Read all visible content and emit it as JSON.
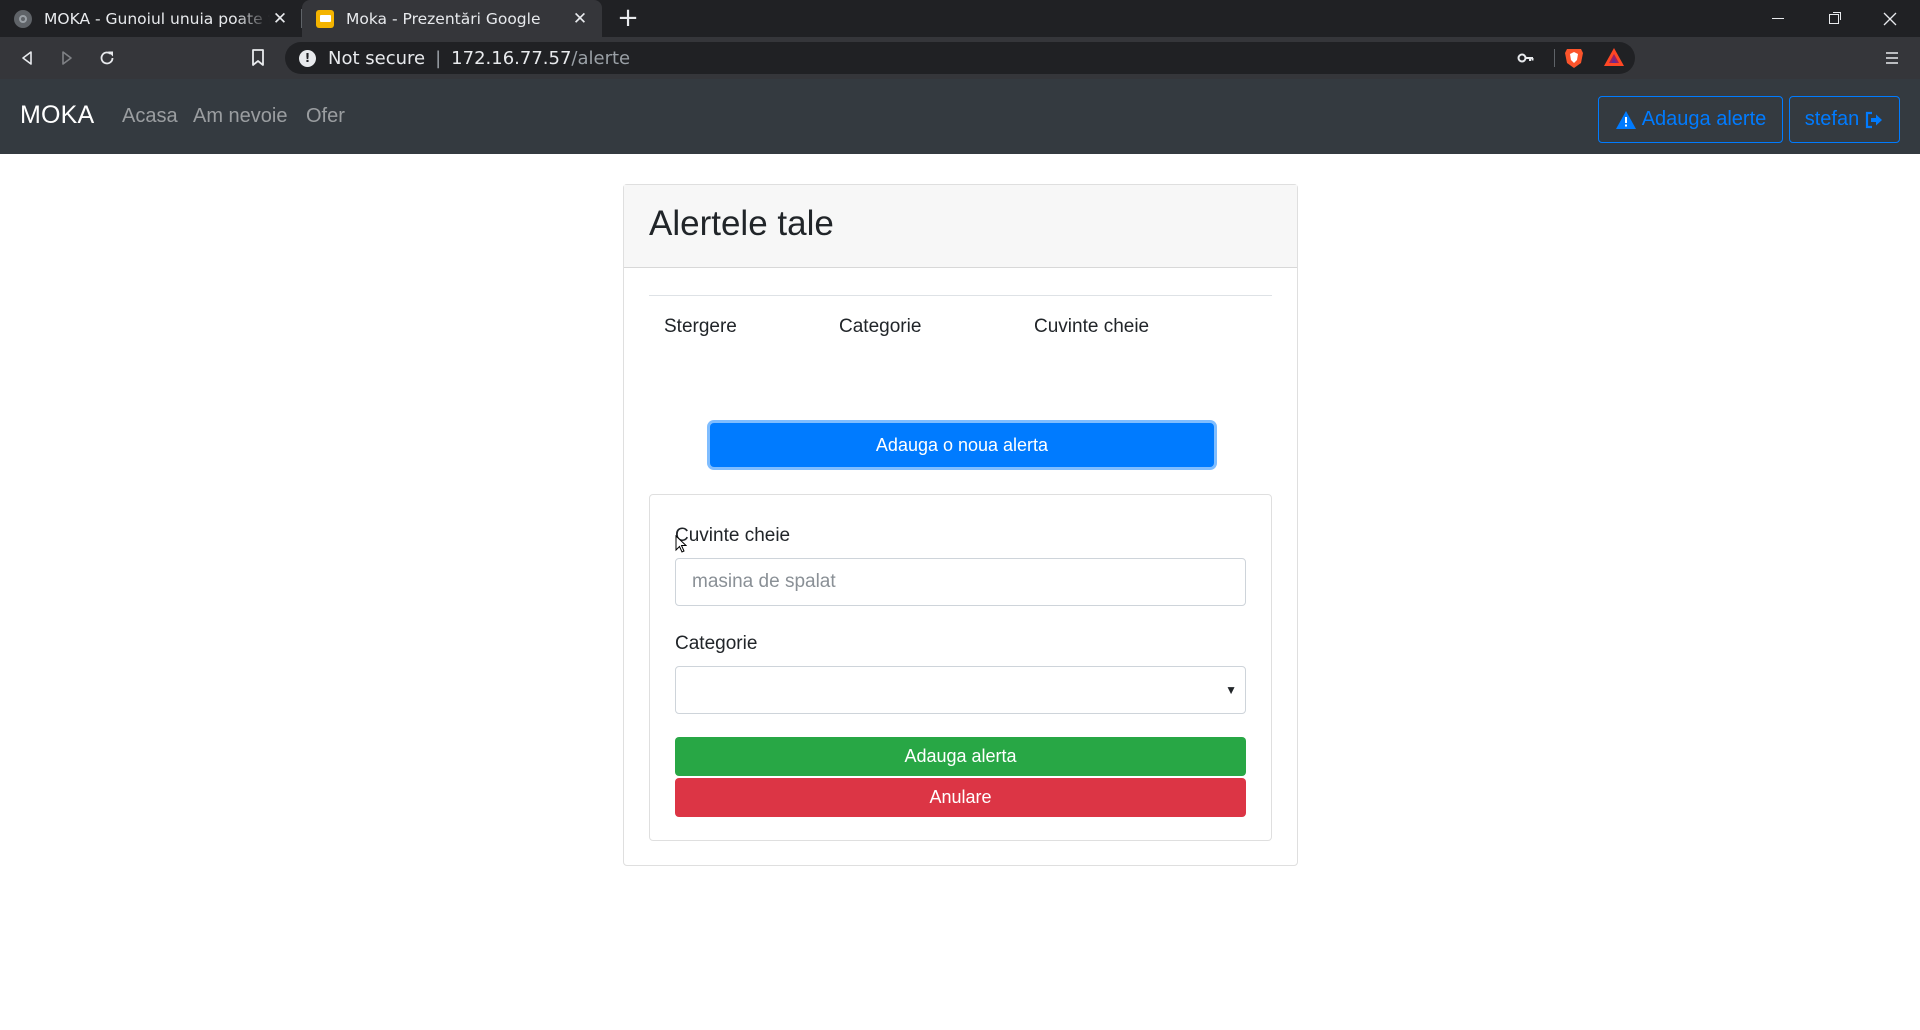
{
  "browser": {
    "tabs": [
      {
        "title": "MOKA - Gunoiul unuia poate fi comoara altuia",
        "active": false
      },
      {
        "title": "Moka - Prezentări Google",
        "active": true
      }
    ],
    "address": {
      "status": "Not secure",
      "host": "172.16.77.57",
      "path": "/alerte"
    }
  },
  "navbar": {
    "brand": "MOKA",
    "links": [
      "Acasa",
      "Am nevoie",
      "Ofer"
    ],
    "add_alerts_label": "Adauga alerte",
    "user_label": "stefan"
  },
  "card": {
    "title": "Alertele tale",
    "table_headers": [
      "Stergere",
      "Categorie",
      "Cuvinte cheie"
    ],
    "new_alert_button": "Adauga o noua alerta"
  },
  "form": {
    "keywords_label": "Cuvinte cheie",
    "keywords_placeholder": "masina de spalat",
    "keywords_value": "",
    "category_label": "Categorie",
    "category_selected": "",
    "submit_label": "Adauga alerta",
    "cancel_label": "Anulare"
  },
  "colors": {
    "primary": "#007bff",
    "success": "#28a745",
    "danger": "#dc3545",
    "navbar_bg": "#343a40"
  },
  "icons": [
    "warning-icon",
    "sign-out-icon",
    "back-icon",
    "forward-icon",
    "reload-icon",
    "bookmark-icon",
    "key-icon",
    "brave-shield-icon",
    "bat-icon",
    "menu-icon"
  ]
}
